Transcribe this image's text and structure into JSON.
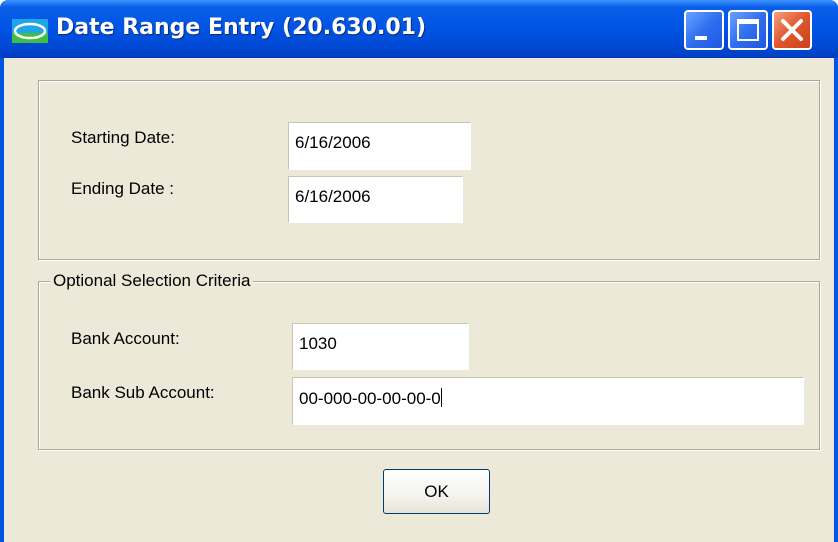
{
  "window": {
    "title": "Date Range Entry (20.630.01)",
    "icon": "app-icon",
    "controls": [
      "minimize-icon",
      "maximize-icon",
      "close-icon"
    ]
  },
  "date_range": {
    "starting_label": "Starting Date:",
    "starting_value": "6/16/2006",
    "ending_label": "Ending Date :",
    "ending_value": "6/16/2006"
  },
  "optional": {
    "legend": "Optional Selection Criteria",
    "bank_account_label": "Bank Account:",
    "bank_account_value": "1030",
    "bank_sub_account_label": "Bank Sub Account:",
    "bank_sub_account_value": "00-000-00-00-00-0"
  },
  "buttons": {
    "ok_label": "OK"
  },
  "colors": {
    "titlebar": "#0055e5",
    "dialog_background": "#ece9d8",
    "close_button": "#e1562d"
  }
}
